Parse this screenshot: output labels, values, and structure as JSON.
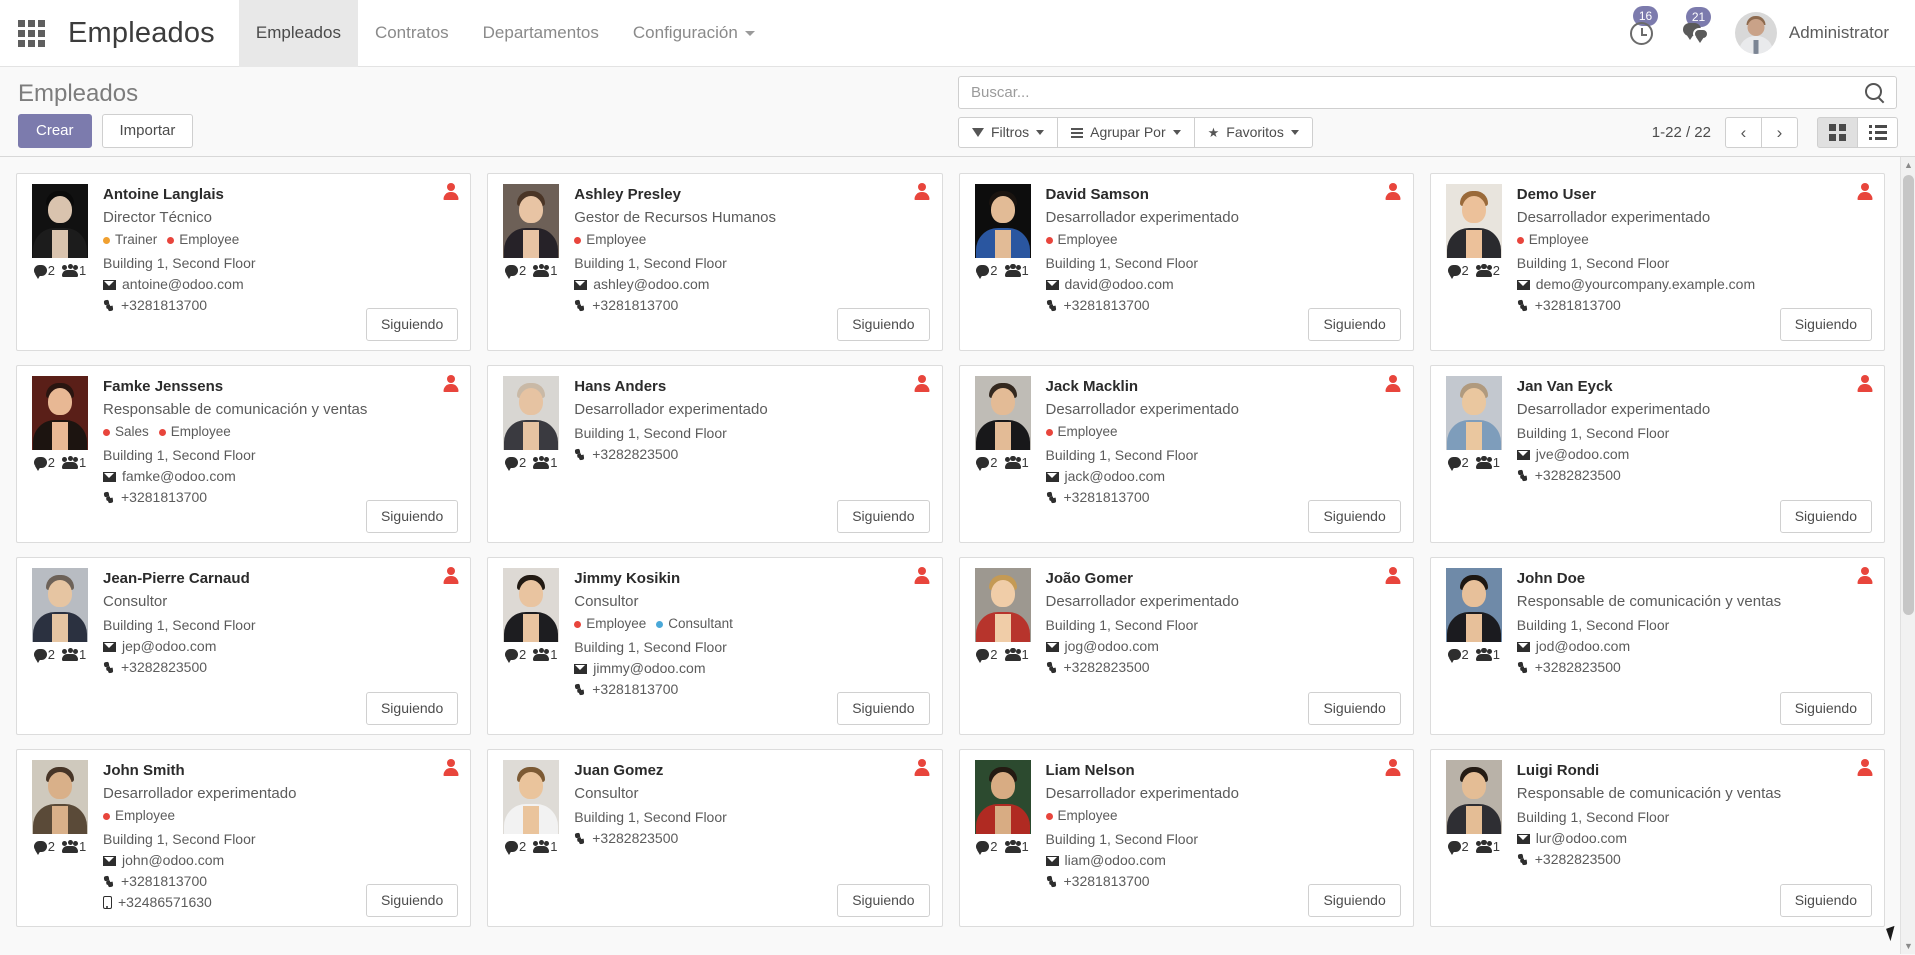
{
  "navbar": {
    "apps_icon": "apps-grid-icon",
    "brand": "Empleados",
    "menu": [
      {
        "label": "Empleados",
        "active": true
      },
      {
        "label": "Contratos",
        "active": false
      },
      {
        "label": "Departamentos",
        "active": false
      },
      {
        "label": "Configuración",
        "active": false,
        "has_caret": true
      }
    ],
    "activity_badge": "16",
    "messages_badge": "21",
    "username": "Administrator"
  },
  "control_panel": {
    "page_title": "Empleados",
    "create_label": "Crear",
    "import_label": "Importar",
    "search_placeholder": "Buscar...",
    "search_value": "",
    "filters_label": "Filtros",
    "groupby_label": "Agrupar Por",
    "favorites_label": "Favoritos",
    "pager": "1-22 / 22",
    "prev_label": "‹",
    "next_label": "›",
    "view_kanban": "kanban-view-icon",
    "view_list": "list-view-icon"
  },
  "colors": {
    "brand_purple": "#7c7bad",
    "tag_red": "#e8453c",
    "tag_orange": "#f0a030",
    "tag_blue": "#4aa8d8",
    "badge_purple": "#7c7bad"
  },
  "follow_label": "Siguiendo",
  "employees": [
    {
      "name": "Antoine Langlais",
      "job": "Director Técnico",
      "tags": [
        {
          "label": "Trainer",
          "color": "#f0a030"
        },
        {
          "label": "Employee",
          "color": "#e8453c"
        }
      ],
      "location": "Building 1, Second Floor",
      "email": "antoine@odoo.com",
      "phone": "+3281813700",
      "mobile": "",
      "messages": "2",
      "followers": "1",
      "photo": {
        "bg": "#111111",
        "skin": "#d9c3ae",
        "hair": "#0a0a0a",
        "cloth": "#1c1c1c"
      }
    },
    {
      "name": "Ashley Presley",
      "job": "Gestor de Recursos Humanos",
      "tags": [
        {
          "label": "Employee",
          "color": "#e8453c"
        }
      ],
      "location": "Building 1, Second Floor",
      "email": "ashley@odoo.com",
      "phone": "+3281813700",
      "mobile": "",
      "messages": "2",
      "followers": "1",
      "photo": {
        "bg": "#6d6057",
        "skin": "#e8c4a4",
        "hair": "#4a3526",
        "cloth": "#262228"
      }
    },
    {
      "name": "David Samson",
      "job": "Desarrollador experimentado",
      "tags": [
        {
          "label": "Employee",
          "color": "#e8453c"
        }
      ],
      "location": "Building 1, Second Floor",
      "email": "david@odoo.com",
      "phone": "+3281813700",
      "mobile": "",
      "messages": "2",
      "followers": "1",
      "photo": {
        "bg": "#0d0d0d",
        "skin": "#e2bb96",
        "hair": "#1a1410",
        "cloth": "#2a56a0"
      }
    },
    {
      "name": "Demo User",
      "job": "Desarrollador experimentado",
      "tags": [
        {
          "label": "Employee",
          "color": "#e8453c"
        }
      ],
      "location": "Building 1, Second Floor",
      "email": "demo@yourcompany.example.com",
      "phone": "+3281813700",
      "mobile": "",
      "messages": "2",
      "followers": "2",
      "photo": {
        "bg": "#e8e4dd",
        "skin": "#ecc19a",
        "hair": "#9a6a3a",
        "cloth": "#2a2a2e"
      }
    },
    {
      "name": "Famke Jenssens",
      "job": "Responsable de comunicación y ventas",
      "tags": [
        {
          "label": "Sales",
          "color": "#e8453c"
        },
        {
          "label": "Employee",
          "color": "#e8453c"
        }
      ],
      "location": "Building 1, Second Floor",
      "email": "famke@odoo.com",
      "phone": "+3281813700",
      "mobile": "",
      "messages": "2",
      "followers": "1",
      "photo": {
        "bg": "#5a1f18",
        "skin": "#e8b894",
        "hair": "#2a1510",
        "cloth": "#1c1410"
      }
    },
    {
      "name": "Hans Anders",
      "job": "Desarrollador experimentado",
      "tags": [],
      "location": "Building 1, Second Floor",
      "email": "",
      "phone": "+3282823500",
      "mobile": "",
      "messages": "2",
      "followers": "1",
      "photo": {
        "bg": "#d8d6d2",
        "skin": "#e6c3a2",
        "hair": "#c9b9a6",
        "cloth": "#3a3a40"
      }
    },
    {
      "name": "Jack Macklin",
      "job": "Desarrollador experimentado",
      "tags": [
        {
          "label": "Employee",
          "color": "#e8453c"
        }
      ],
      "location": "Building 1, Second Floor",
      "email": "jack@odoo.com",
      "phone": "+3281813700",
      "mobile": "",
      "messages": "2",
      "followers": "1",
      "photo": {
        "bg": "#bfbcb6",
        "skin": "#e3bb96",
        "hair": "#33281f",
        "cloth": "#18181a"
      }
    },
    {
      "name": "Jan Van Eyck",
      "job": "Desarrollador experimentado",
      "tags": [],
      "location": "Building 1, Second Floor",
      "email": "jve@odoo.com",
      "phone": "+3282823500",
      "mobile": "",
      "messages": "2",
      "followers": "1",
      "photo": {
        "bg": "#c3c8cf",
        "skin": "#eac79f",
        "hair": "#b09a7e",
        "cloth": "#7e9dbb"
      }
    },
    {
      "name": "Jean-Pierre Carnaud",
      "job": "Consultor",
      "tags": [],
      "location": "Building 1, Second Floor",
      "email": "jep@odoo.com",
      "phone": "+3282823500",
      "mobile": "",
      "messages": "2",
      "followers": "1",
      "photo": {
        "bg": "#b8bcc2",
        "skin": "#e6c5a2",
        "hair": "#6d6258",
        "cloth": "#2b3140"
      }
    },
    {
      "name": "Jimmy Kosikin",
      "job": "Consultor",
      "tags": [
        {
          "label": "Employee",
          "color": "#e8453c"
        },
        {
          "label": "Consultant",
          "color": "#4aa8d8"
        }
      ],
      "location": "Building 1, Second Floor",
      "email": "jimmy@odoo.com",
      "phone": "+3281813700",
      "mobile": "",
      "messages": "2",
      "followers": "1",
      "photo": {
        "bg": "#ddd9d4",
        "skin": "#e9c4a0",
        "hair": "#221a13",
        "cloth": "#1d1d20"
      }
    },
    {
      "name": "João Gomer",
      "job": "Desarrollador experimentado",
      "tags": [],
      "location": "Building 1, Second Floor",
      "email": "jog@odoo.com",
      "phone": "+3282823500",
      "mobile": "",
      "messages": "2",
      "followers": "1",
      "photo": {
        "bg": "#9d9890",
        "skin": "#f0cda8",
        "hair": "#c49a55",
        "cloth": "#b7342c"
      }
    },
    {
      "name": "John Doe",
      "job": "Responsable de comunicación y ventas",
      "tags": [],
      "location": "Building 1, Second Floor",
      "email": "jod@odoo.com",
      "phone": "+3282823500",
      "mobile": "",
      "messages": "2",
      "followers": "1",
      "photo": {
        "bg": "#6f8aa8",
        "skin": "#e7c09a",
        "hair": "#1d1712",
        "cloth": "#1b1b1f"
      }
    },
    {
      "name": "John Smith",
      "job": "Desarrollador experimentado",
      "tags": [
        {
          "label": "Employee",
          "color": "#e8453c"
        }
      ],
      "location": "Building 1, Second Floor",
      "email": "john@odoo.com",
      "phone": "+3281813700",
      "mobile": "+32486571630",
      "messages": "2",
      "followers": "1",
      "photo": {
        "bg": "#cfc9bd",
        "skin": "#d9b089",
        "hair": "#473527",
        "cloth": "#5a4a38"
      }
    },
    {
      "name": "Juan Gomez",
      "job": "Consultor",
      "tags": [],
      "location": "Building 1, Second Floor",
      "email": "",
      "phone": "+3282823500",
      "mobile": "",
      "messages": "2",
      "followers": "1",
      "photo": {
        "bg": "#dedbd6",
        "skin": "#eac49c",
        "hair": "#7c5a34",
        "cloth": "#f2f2f2"
      }
    },
    {
      "name": "Liam Nelson",
      "job": "Desarrollador experimentado",
      "tags": [
        {
          "label": "Employee",
          "color": "#e8453c"
        }
      ],
      "location": "Building 1, Second Floor",
      "email": "liam@odoo.com",
      "phone": "+3281813700",
      "mobile": "",
      "messages": "2",
      "followers": "1",
      "photo": {
        "bg": "#2c4a2f",
        "skin": "#d8ac83",
        "hair": "#241a12",
        "cloth": "#b02a22"
      }
    },
    {
      "name": "Luigi Rondi",
      "job": "Responsable de comunicación y ventas",
      "tags": [],
      "location": "Building 1, Second Floor",
      "email": "lur@odoo.com",
      "phone": "+3282823500",
      "mobile": "",
      "messages": "2",
      "followers": "1",
      "photo": {
        "bg": "#b9b2a8",
        "skin": "#e4bd95",
        "hair": "#241b14",
        "cloth": "#2e2e33"
      }
    }
  ]
}
